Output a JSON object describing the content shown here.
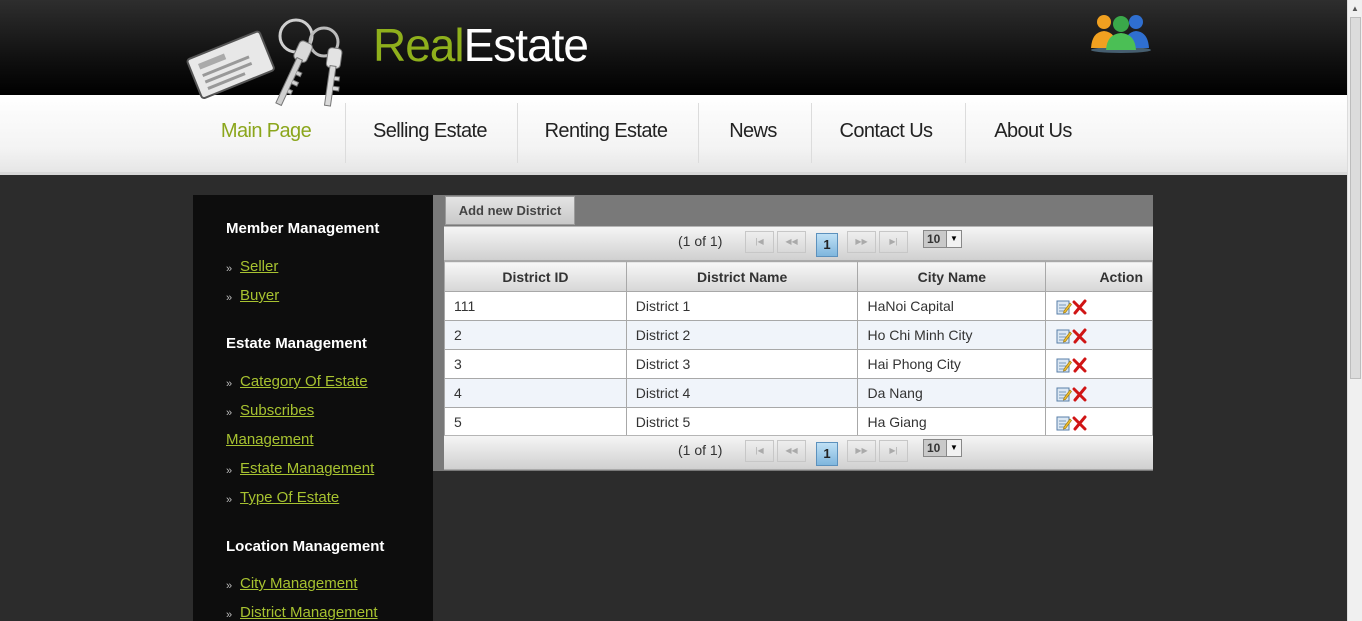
{
  "header": {
    "brand_word1": "Real",
    "brand_word2": "Estate"
  },
  "nav": {
    "items": [
      {
        "label": "Main Page",
        "active": true
      },
      {
        "label": "Selling Estate"
      },
      {
        "label": "Renting Estate"
      },
      {
        "label": "News"
      },
      {
        "label": "Contact Us"
      },
      {
        "label": "About Us"
      }
    ]
  },
  "sidebar": {
    "sections": [
      {
        "title": "Member Management",
        "links": [
          "Seller",
          "Buyer"
        ]
      },
      {
        "title": "Estate Management",
        "links": [
          "Category Of Estate",
          "Subscribes",
          "Management",
          "Estate Management",
          "Type Of Estate"
        ]
      },
      {
        "title": "Location Management",
        "links": [
          "City Management",
          "District Management"
        ]
      }
    ]
  },
  "main": {
    "add_button": "Add new District",
    "pager": {
      "status": "(1 of 1)",
      "current_page": "1",
      "rows_per_page": "10",
      "first_glyph": "|◀",
      "prev_glyph": "◀◀",
      "next_glyph": "▶▶",
      "last_glyph": "▶|",
      "dropdown_glyph": "▼"
    },
    "columns": [
      "District ID",
      "District Name",
      "City Name",
      "Action"
    ],
    "rows": [
      {
        "id": "111",
        "name": "District 1",
        "city": "HaNoi Capital"
      },
      {
        "id": "2",
        "name": "District 2",
        "city": "Ho Chi Minh City"
      },
      {
        "id": "3",
        "name": "District 3",
        "city": "Hai Phong City"
      },
      {
        "id": "4",
        "name": "District 4",
        "city": "Da Nang"
      },
      {
        "id": "5",
        "name": "District 5",
        "city": "Ha Giang"
      }
    ]
  },
  "icons": {
    "sidebar_bullet": "»",
    "edit_icon": "edit-icon",
    "delete_icon": "delete-icon",
    "users_icon": "users-icon",
    "keys_logo": "keys-logo"
  },
  "colors": {
    "brand_green": "#8fb01c",
    "link_green": "#a7c230",
    "sidebar_bg": "#0d0d0d",
    "page_bg": "#2c2c2c"
  }
}
